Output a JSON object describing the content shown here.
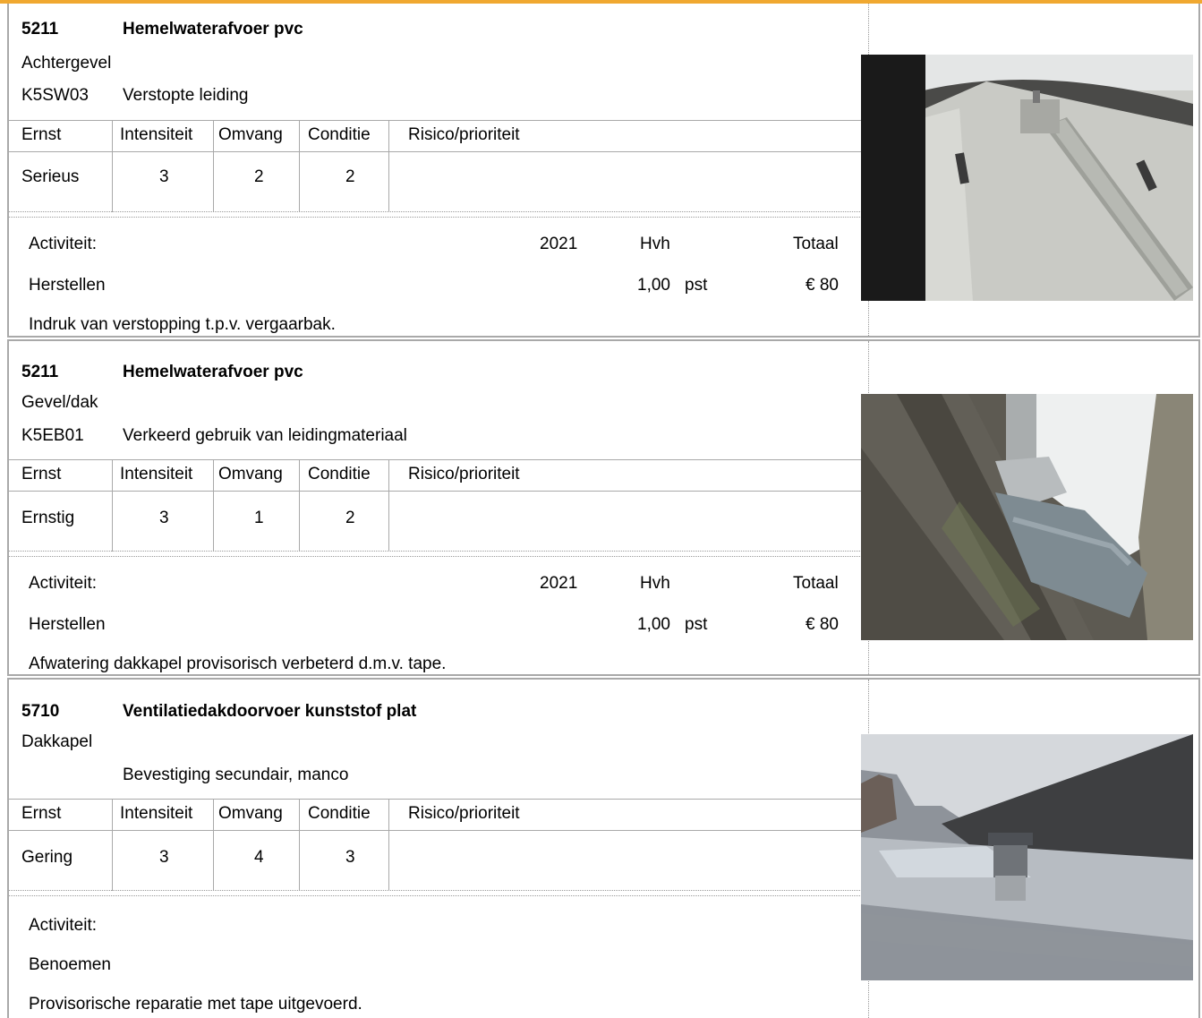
{
  "table_headers": {
    "ernst": "Ernst",
    "intensiteit": "Intensiteit",
    "omvang": "Omvang",
    "conditie": "Conditie",
    "risico": "Risico/prioriteit"
  },
  "labels": {
    "activiteit": "Activiteit:",
    "year": "2021",
    "hvh": "Hvh",
    "totaal": "Totaal"
  },
  "items": [
    {
      "code": "5211",
      "title": "Hemelwaterafvoer pvc",
      "location": "Achtergevel",
      "defect_code": "K5SW03",
      "defect": "Verstopte leiding",
      "ernst": "Serieus",
      "intensiteit": "3",
      "omvang": "2",
      "conditie": "2",
      "activity": "Herstellen",
      "quantity": "1,00",
      "unit": "pst",
      "total": "€ 80",
      "note": "Indruk van verstopping t.p.v. vergaarbak."
    },
    {
      "code": "5211",
      "title": "Hemelwaterafvoer pvc",
      "location": "Gevel/dak",
      "defect_code": "K5EB01",
      "defect": "Verkeerd gebruik van leidingmateriaal",
      "ernst": "Ernstig",
      "intensiteit": "3",
      "omvang": "1",
      "conditie": "2",
      "activity": "Herstellen",
      "quantity": "1,00",
      "unit": "pst",
      "total": "€ 80",
      "note": "Afwatering dakkapel provisorisch verbeterd d.m.v. tape."
    },
    {
      "code": "5710",
      "title": "Ventilatiedakdoorvoer kunststof plat",
      "location": "Dakkapel",
      "defect_code": "",
      "defect": "Bevestiging secundair, manco",
      "ernst": "Gering",
      "intensiteit": "3",
      "omvang": "4",
      "conditie": "3",
      "activity": "Benoemen",
      "note": "Provisorische reparatie met tape uitgevoerd."
    }
  ],
  "colors": {
    "accent": "#f0a830",
    "border": "#a9a9a9"
  }
}
